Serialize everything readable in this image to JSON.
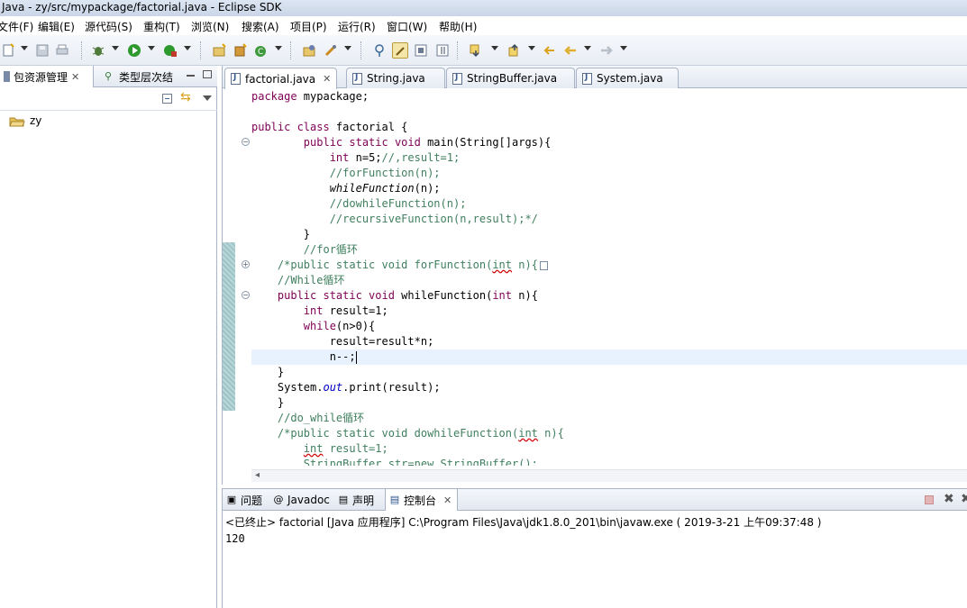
{
  "window": {
    "title": "Java  -  zy/src/mypackage/factorial.java  -  Eclipse SDK"
  },
  "menu": [
    "文件(F)",
    "编辑(E)",
    "源代码(S)",
    "重构(T)",
    "浏览(N)",
    "搜索(A)",
    "项目(P)",
    "运行(R)",
    "窗口(W)",
    "帮助(H)"
  ],
  "toolbar": {
    "icons": [
      "new-icon",
      "save-icon",
      "print-icon",
      "debug-icon",
      "run-icon",
      "external-tools-icon",
      "new-java-project-icon",
      "new-package-icon",
      "new-class-icon",
      "open-type-icon",
      "search-icon",
      "toggle-mark-occurrences-icon",
      "toggle-block-selection-icon",
      "show-whitespace-icon",
      "next-annotation-icon",
      "previous-annotation-icon",
      "back-icon",
      "forward-icon"
    ]
  },
  "left_panel": {
    "tabs": [
      {
        "label": "包资源管理",
        "icon": "package-explorer-icon"
      },
      {
        "label": "类型层次结",
        "icon": "type-hierarchy-icon"
      }
    ],
    "tree": [
      {
        "label": "zy",
        "icon": "project-folder-icon"
      }
    ]
  },
  "editor": {
    "tabs": [
      {
        "label": "factorial.java",
        "active": true
      },
      {
        "label": "String.java",
        "active": false
      },
      {
        "label": "StringBuffer.java",
        "active": false
      },
      {
        "label": "System.java",
        "active": false
      }
    ],
    "lines": [
      "package mypackage;",
      "",
      "public class factorial {",
      "        public static void main(String[]args){",
      "            int n=5;//,result=1;",
      "            //forFunction(n);",
      "            whileFunction(n);",
      "            //dowhileFunction(n);",
      "            //recursiveFunction(n,result);*/",
      "        }",
      "        //for循环",
      "    /*public static void forFunction(int n){",
      "    //While循环",
      "    public static void whileFunction(int n){",
      "        int result=1;",
      "        while(n>0){",
      "            result=result*n;",
      "            n--;",
      "    }",
      "    System.out.print(result);",
      "    }",
      "    //do_while循环",
      "    /*public static void dowhileFunction(int n){",
      "        int result=1;",
      "        StringBuffer str=new StringBuffer();"
    ]
  },
  "console": {
    "tabs": [
      {
        "label": "问题",
        "icon": "problems-icon"
      },
      {
        "label": "Javadoc",
        "icon": "javadoc-icon"
      },
      {
        "label": "声明",
        "icon": "declaration-icon"
      },
      {
        "label": "控制台",
        "icon": "console-icon",
        "active": true
      }
    ],
    "status": "<已终止> factorial [Java 应用程序] C:\\Program Files\\Java\\jdk1.8.0_201\\bin\\javaw.exe ( 2019-3-21 上午09:37:48 )",
    "output": "120"
  }
}
